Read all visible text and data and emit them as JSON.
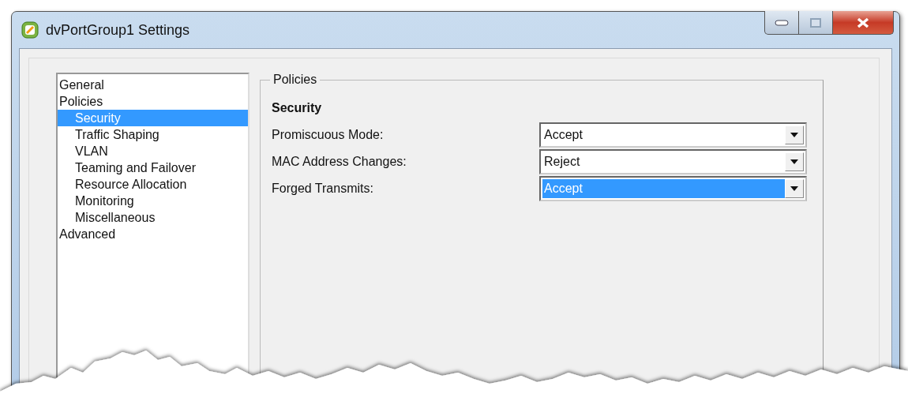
{
  "window": {
    "title": "dvPortGroup1 Settings"
  },
  "tree": [
    {
      "label": "General",
      "selected": false
    },
    {
      "label": "Policies",
      "selected": false,
      "children": [
        {
          "label": "Security",
          "selected": true
        },
        {
          "label": "Traffic Shaping",
          "selected": false
        },
        {
          "label": "VLAN",
          "selected": false
        },
        {
          "label": "Teaming and Failover",
          "selected": false
        },
        {
          "label": "Resource Allocation",
          "selected": false
        },
        {
          "label": "Monitoring",
          "selected": false
        },
        {
          "label": "Miscellaneous",
          "selected": false
        }
      ]
    },
    {
      "label": "Advanced",
      "selected": false
    }
  ],
  "policies": {
    "legend": "Policies",
    "section": "Security",
    "settings": [
      {
        "label": "Promiscuous Mode:",
        "value": "Accept",
        "highlighted": false
      },
      {
        "label": "MAC Address Changes:",
        "value": "Reject",
        "highlighted": false
      },
      {
        "label": "Forged Transmits:",
        "value": "Accept",
        "highlighted": true
      }
    ]
  }
}
